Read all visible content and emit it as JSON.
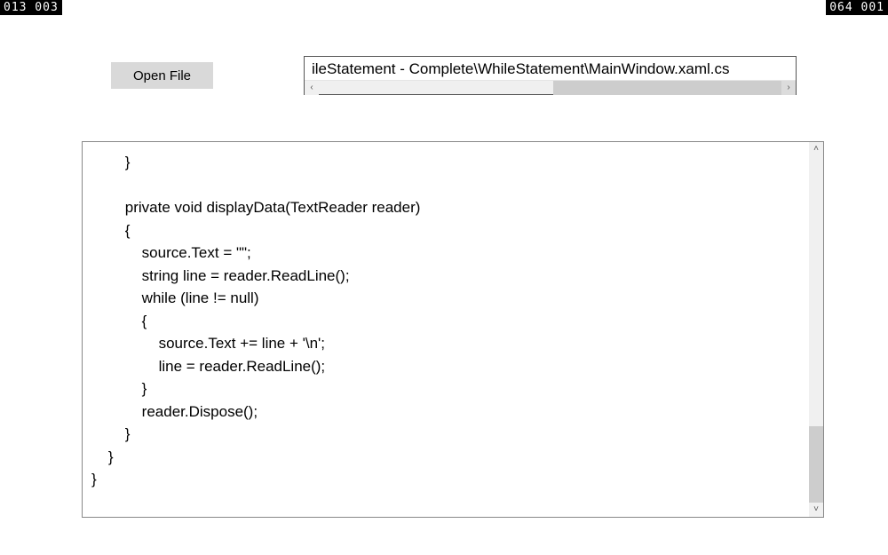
{
  "corners": {
    "top_left": "013  003",
    "top_right": "064  001"
  },
  "toolbar": {
    "open_file_label": "Open File"
  },
  "path_field": {
    "visible_text": "ileStatement - Complete\\WhileStatement\\MainWindow.xaml.cs"
  },
  "code": {
    "lines": [
      "        }",
      "",
      "        private void displayData(TextReader reader)",
      "        {",
      "            source.Text = \"\";",
      "            string line = reader.ReadLine();",
      "            while (line != null)",
      "            {",
      "                source.Text += line + '\\n';",
      "                line = reader.ReadLine();",
      "            }",
      "            reader.Dispose();",
      "        }",
      "    }",
      "}"
    ]
  }
}
